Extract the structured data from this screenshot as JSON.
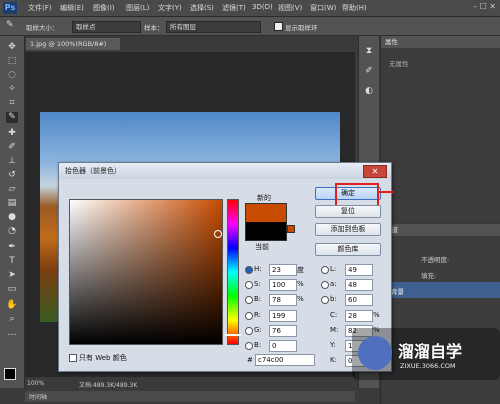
{
  "menubar": {
    "logo": "Ps",
    "items": [
      "文件(F)",
      "编辑(E)",
      "图像(I)",
      "图层(L)",
      "文字(Y)",
      "选择(S)",
      "滤镜(T)",
      "3D(D)",
      "视图(V)",
      "窗口(W)",
      "帮助(H)"
    ],
    "win_controls": "–  ☐  ✕"
  },
  "options": {
    "sample_size_label": "取样大小：",
    "sample_size_value": "取样点",
    "sample_label": "样本：",
    "sample_value": "所有图层",
    "show_ring_label": "显示取样环"
  },
  "document": {
    "tab": "1.jpg @ 100%(RGB/8#)",
    "zoom": "100%",
    "doc_size": "文档:489.3K/489.3K",
    "bottom_tab": "时间轴"
  },
  "properties": {
    "title": "属性",
    "empty_text": "无属性"
  },
  "layers": {
    "title": "通道",
    "opacity_label": "不透明度:",
    "fill_label": "填充:",
    "layer_name": "背景"
  },
  "dialog": {
    "title": "拾色器（前景色）",
    "close": "✕",
    "new_label": "新的",
    "current_label": "当前",
    "ok": "确定",
    "cancel": "复位",
    "add_swatch": "添加到色板",
    "color_libs": "颜色库",
    "web_only": "只有 Web 颜色",
    "new_color": "#c74c00",
    "current_color": "#000000",
    "highlight_color": "#e02020",
    "fields": {
      "H": {
        "label": "H:",
        "value": "23",
        "unit": "度"
      },
      "S": {
        "label": "S:",
        "value": "100",
        "unit": "%"
      },
      "B": {
        "label": "B:",
        "value": "78",
        "unit": "%"
      },
      "R": {
        "label": "R:",
        "value": "199",
        "unit": ""
      },
      "G": {
        "label": "G:",
        "value": "76",
        "unit": ""
      },
      "Bl": {
        "label": "B:",
        "value": "0",
        "unit": ""
      },
      "L": {
        "label": "L:",
        "value": "49",
        "unit": ""
      },
      "a": {
        "label": "a:",
        "value": "48",
        "unit": ""
      },
      "b": {
        "label": "b:",
        "value": "60",
        "unit": ""
      },
      "C": {
        "label": "C:",
        "value": "28",
        "unit": "%"
      },
      "M": {
        "label": "M:",
        "value": "82",
        "unit": "%"
      },
      "Y": {
        "label": "Y:",
        "value": "1",
        "unit": ""
      },
      "K": {
        "label": "K:",
        "value": "0",
        "unit": ""
      },
      "hex": {
        "label": "#",
        "value": "c74c00"
      }
    }
  },
  "watermark": {
    "title": "溜溜自学",
    "url": "ZIXUE.3066.COM"
  }
}
